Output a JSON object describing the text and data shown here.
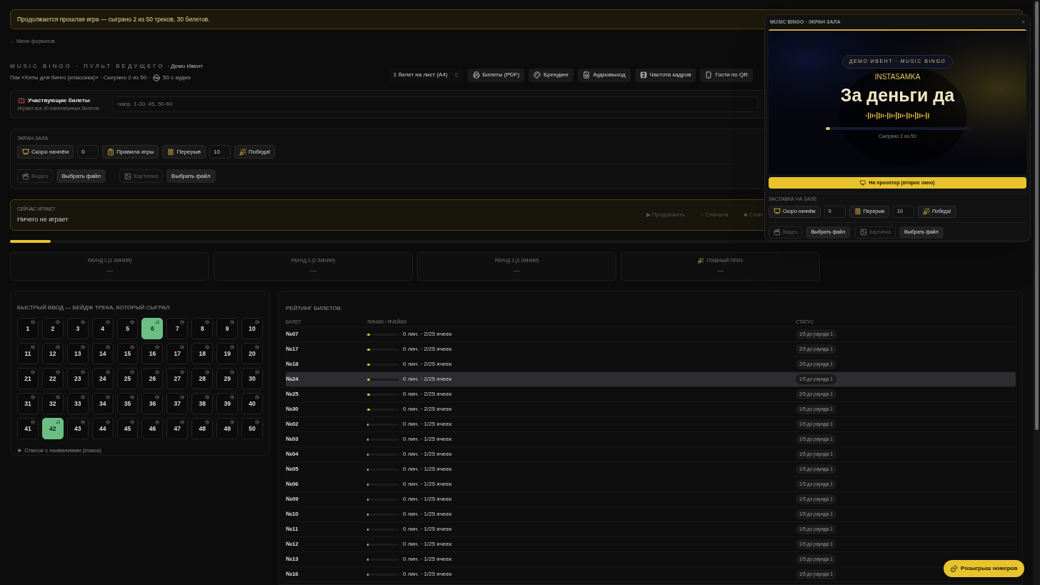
{
  "banner": "Продолжается прошлая игра — сыграно 2 из 50 треков, 30 билетов.",
  "back_link": "← Меню форматов",
  "header": {
    "title": "MUSIC BINGO · ПУЛЬТ ВЕДУЩЕГО",
    "event": "· Демо Ивент",
    "subtitle": "Пак «Хиты для бинго (классика)» · Сыграно 2 из 50 ·",
    "audio_count": "50 с аудио"
  },
  "toolbar": {
    "per_sheet": "1 билет на лист (A4)",
    "buttons": [
      "Билеты (PDF)",
      "Брендинг",
      "Аудиовыход",
      "Частота кадров",
      "Гости по QR"
    ]
  },
  "tickets_panel": {
    "title": "Участвующие билеты",
    "hint": "Играют все 30 напечатанных билетов",
    "placeholder": "напр. 1-30, 45, 50-60"
  },
  "hall_screen": {
    "title": "ЭКРАН ЗАЛА",
    "controls": [
      {
        "kind": "button",
        "label": "Скоро начнём"
      },
      {
        "kind": "number",
        "value": "0"
      },
      {
        "kind": "button",
        "label": "Правила игры"
      },
      {
        "kind": "button",
        "label": "Перерыв"
      },
      {
        "kind": "number",
        "value": "10"
      },
      {
        "kind": "button",
        "label": "Победа!"
      }
    ],
    "media": [
      {
        "kind": "media",
        "label": "Видео",
        "disabled": true
      },
      {
        "kind": "file",
        "label": "Выбрать файл"
      },
      {
        "kind": "media",
        "label": "Картинка",
        "disabled": true
      },
      {
        "kind": "file",
        "label": "Выбрать файл"
      }
    ]
  },
  "now_playing": {
    "label": "СЕЙЧАС ИГРАЕТ",
    "value": "Ничего не играет",
    "actions": [
      "▶ Продолжить",
      "○ Сначала",
      "■ Стоп"
    ],
    "level": 0.04
  },
  "rounds": [
    {
      "title": "РАУНД 1 (1 ЛИНИЯ)",
      "value": "—"
    },
    {
      "title": "РАУНД 2 (2 ЛИНИИ)",
      "value": "—"
    },
    {
      "title": "РАУНД 3 (3 ЛИНИИ)",
      "value": "—"
    },
    {
      "title": "ГЛАВНЫЙ ПРИЗ",
      "value": "—"
    }
  ],
  "quick_entry": {
    "title": "БЫСТРЫЙ ВВОД — БЕЙДЖ ТРЕКА, КОТОРЫЙ СЫГРАЛ",
    "tracks": [
      {
        "label": "1",
        "played": false
      },
      {
        "label": "2",
        "played": false
      },
      {
        "label": "3",
        "played": false
      },
      {
        "label": "4",
        "played": false
      },
      {
        "label": "5",
        "played": false
      },
      {
        "label": "6",
        "played": true
      },
      {
        "label": "7",
        "played": false
      },
      {
        "label": "8",
        "played": false
      },
      {
        "label": "9",
        "played": false
      },
      {
        "label": "10",
        "played": false
      },
      {
        "label": "11",
        "played": false
      },
      {
        "label": "12",
        "played": false
      },
      {
        "label": "13",
        "played": false
      },
      {
        "label": "14",
        "played": false
      },
      {
        "label": "15",
        "played": false
      },
      {
        "label": "16",
        "played": false
      },
      {
        "label": "17",
        "played": false
      },
      {
        "label": "18",
        "played": false
      },
      {
        "label": "19",
        "played": false
      },
      {
        "label": "20",
        "played": false
      },
      {
        "label": "21",
        "played": false
      },
      {
        "label": "22",
        "played": false
      },
      {
        "label": "23",
        "played": false
      },
      {
        "label": "24",
        "played": false
      },
      {
        "label": "25",
        "played": false
      },
      {
        "label": "26",
        "played": false
      },
      {
        "label": "27",
        "played": false
      },
      {
        "label": "28",
        "played": false
      },
      {
        "label": "29",
        "played": false
      },
      {
        "label": "30",
        "played": false
      },
      {
        "label": "31",
        "played": false
      },
      {
        "label": "32",
        "played": false
      },
      {
        "label": "33",
        "played": false
      },
      {
        "label": "34",
        "played": false
      },
      {
        "label": "35",
        "played": false
      },
      {
        "label": "36",
        "played": false
      },
      {
        "label": "37",
        "played": false
      },
      {
        "label": "38",
        "played": false
      },
      {
        "label": "39",
        "played": false
      },
      {
        "label": "40",
        "played": false
      },
      {
        "label": "41",
        "played": false
      },
      {
        "label": "42",
        "played": true
      },
      {
        "label": "43",
        "played": false
      },
      {
        "label": "44",
        "played": false
      },
      {
        "label": "45",
        "played": false
      },
      {
        "label": "46",
        "played": false
      },
      {
        "label": "47",
        "played": false
      },
      {
        "label": "48",
        "played": false
      },
      {
        "label": "49",
        "played": false
      },
      {
        "label": "50",
        "played": false
      }
    ],
    "list_toggle": "► Список с названиями (поиск)"
  },
  "rating": {
    "title": "РЕЙТИНГ БИЛЕТОВ",
    "columns": [
      "БИЛЕТ",
      "ЛИНИИ / ЯЧЕЙКИ",
      "СТАТУС"
    ],
    "rows": [
      {
        "ticket": "№07",
        "level": 0.08,
        "progress": "0 лин. · 2/25 ячеек",
        "status": "1/5 до раунда 1",
        "selected": false
      },
      {
        "ticket": "№17",
        "level": 0.08,
        "progress": "0 лин. · 2/25 ячеек",
        "status": "2/5 до раунда 1",
        "selected": false
      },
      {
        "ticket": "№18",
        "level": 0.08,
        "progress": "0 лин. · 2/25 ячеек",
        "status": "2/5 до раунда 1",
        "selected": false
      },
      {
        "ticket": "№24",
        "level": 0.08,
        "progress": "0 лин. · 2/25 ячеек",
        "status": "1/5 до раунда 1",
        "selected": true
      },
      {
        "ticket": "№25",
        "level": 0.08,
        "progress": "0 лин. · 2/25 ячеек",
        "status": "2/5 до раунда 1",
        "selected": false
      },
      {
        "ticket": "№30",
        "level": 0.08,
        "progress": "0 лин. · 2/25 ячеек",
        "status": "1/5 до раунда 1",
        "selected": false
      },
      {
        "ticket": "№02",
        "level": 0.04,
        "progress": "0 лин. · 1/25 ячеек",
        "status": "1/5 до раунда 1",
        "selected": false
      },
      {
        "ticket": "№03",
        "level": 0.04,
        "progress": "0 лин. · 1/25 ячеек",
        "status": "1/5 до раунда 1",
        "selected": false
      },
      {
        "ticket": "№04",
        "level": 0.04,
        "progress": "0 лин. · 1/25 ячеек",
        "status": "1/5 до раунда 1",
        "selected": false
      },
      {
        "ticket": "№05",
        "level": 0.04,
        "progress": "0 лин. · 1/25 ячеек",
        "status": "1/5 до раунда 1",
        "selected": false
      },
      {
        "ticket": "№06",
        "level": 0.04,
        "progress": "0 лин. · 1/25 ячеек",
        "status": "1/5 до раунда 1",
        "selected": false
      },
      {
        "ticket": "№09",
        "level": 0.04,
        "progress": "0 лин. · 1/25 ячеек",
        "status": "1/5 до раунда 1",
        "selected": false
      },
      {
        "ticket": "№10",
        "level": 0.04,
        "progress": "0 лин. · 1/25 ячеек",
        "status": "1/5 до раунда 1",
        "selected": false
      },
      {
        "ticket": "№11",
        "level": 0.04,
        "progress": "0 лин. · 1/25 ячеек",
        "status": "1/5 до раунда 1",
        "selected": false
      },
      {
        "ticket": "№12",
        "level": 0.04,
        "progress": "0 лин. · 1/25 ячеек",
        "status": "1/5 до раунда 1",
        "selected": false
      },
      {
        "ticket": "№13",
        "level": 0.04,
        "progress": "0 лин. · 1/25 ячеек",
        "status": "1/5 до раунда 1",
        "selected": false
      },
      {
        "ticket": "№16",
        "level": 0.04,
        "progress": "0 лин. · 1/25 ячеек",
        "status": "1/5 до раунда 1",
        "selected": false
      }
    ]
  },
  "hall_window": {
    "title": "MUSIC BINGO · ЭКРАН ЗАЛА",
    "close": "×",
    "preview": {
      "pill": "ДЕМО ИВЕНТ · MUSIC BINGO",
      "artist": "INSTASAMKA",
      "song": "За деньги да",
      "level": 0.03,
      "played": "Сыграно 2 из 50"
    },
    "projector_button": "На проектор (второе окно)",
    "splash_label": "ЗАСТАВКА НА ЗАЛЕ",
    "controls": [
      {
        "kind": "button",
        "label": "Скоро начнём"
      },
      {
        "kind": "number",
        "value": "0"
      },
      {
        "kind": "button",
        "label": "Перерыв"
      },
      {
        "kind": "number",
        "value": "10"
      },
      {
        "kind": "button",
        "label": "Победа!"
      }
    ],
    "media": [
      {
        "kind": "media",
        "label": "Видео",
        "disabled": true
      },
      {
        "kind": "file",
        "label": "Выбрать файл"
      },
      {
        "kind": "media",
        "label": "Картинка",
        "disabled": true
      },
      {
        "kind": "file",
        "label": "Выбрать файл"
      }
    ]
  },
  "draw_button": "Розыгрыш номеров"
}
